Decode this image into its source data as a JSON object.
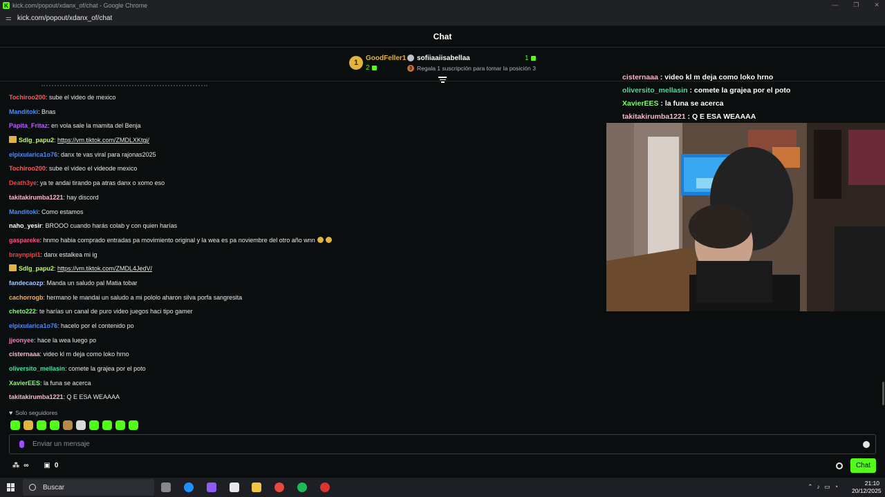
{
  "browser": {
    "window_title": "kick.com/popout/xdanx_of/chat - Google Chrome",
    "url": "kick.com/popout/xdanx_of/chat"
  },
  "chat": {
    "title": "Chat",
    "leaderboard": {
      "first": {
        "rank": "1",
        "name": "GoodFeller1",
        "count": "2"
      },
      "second": {
        "name": "sofiiaaiisabellaa",
        "count": "1"
      },
      "prompt": {
        "rank": "3",
        "text": "Regala 1 suscripción para tomar la posición 3"
      }
    },
    "messages": [
      {
        "user": "Tochiroo200",
        "color": "#ff5b5b",
        "text": ": sube el video de mexico"
      },
      {
        "user": "Manditoki",
        "color": "#4a8cff",
        "text": ": Bnas"
      },
      {
        "user": "Papita_Fritaz",
        "color": "#c15cff",
        "text": ": en vola sale la mamita del Benja"
      },
      {
        "user": "Sdlg_papu2",
        "color": "#b6ff5a",
        "text": ": ",
        "link": "https://vm.tiktok.com/ZMDLXKtgj/",
        "crown": true
      },
      {
        "user": "elpixularica1o76",
        "color": "#4a8cff",
        "text": ": danx te vas viral para rajonas2025"
      },
      {
        "user": "Tochiroo200",
        "color": "#ff5b5b",
        "text": ": sube el video el videode mexico"
      },
      {
        "user": "Death3ye",
        "color": "#ff3e3e",
        "text": ": ya te andai tirando pa atras danx o xomo eso"
      },
      {
        "user": "takitakirumba1221",
        "color": "#ffb8c8",
        "text": ": hay discord"
      },
      {
        "user": "Manditoki",
        "color": "#4a8cff",
        "text": ": Como estamos"
      },
      {
        "user": "naho_yesir",
        "color": "#ffffff",
        "text": ": BROOO cuando harás colab y con quien harías"
      },
      {
        "user": "gaspareke",
        "color": "#ff4e8a",
        "text": ": hnmo habia comprado entradas pa movimiento original y la wea es pa noviembre del otro año wnn",
        "emotes": 2
      },
      {
        "user": "braynpipi1",
        "color": "#ff3e3e",
        "text": ": danx estalkea mi ig"
      },
      {
        "user": "Sdlg_papu2",
        "color": "#b6ff5a",
        "text": ": ",
        "link": "https://vm.tiktok.com/ZMDL4JedV/",
        "crown": true
      },
      {
        "user": "fandecaozp",
        "color": "#a8c8ff",
        "text": ": Manda un saludo pal Matia tobar"
      },
      {
        "user": "cachorrogb",
        "color": "#ffb04a",
        "text": ": hermano le mandai un saludo a mi pololo aharon silva porfa sangresita"
      },
      {
        "user": "cheto222",
        "color": "#7dff6a",
        "text": ": te harías un canal de puro video juegos haci tipo gamer"
      },
      {
        "user": "elpixularica1o76",
        "color": "#4a8cff",
        "text": ": hacelo por el contenido po"
      },
      {
        "user": "jjeonyee",
        "color": "#ff78c0",
        "text": ": hace la wea luego po"
      },
      {
        "user": "cisternaaa",
        "color": "#ffb8c8",
        "text": ": video kl m deja como loko hrno"
      },
      {
        "user": "oliversito_mellasin",
        "color": "#4ae0a0",
        "text": ": comete la grajea por el poto"
      },
      {
        "user": "XavierEES",
        "color": "#7dff6a",
        "text": ": la funa se acerca"
      },
      {
        "user": "takitakirumba1221",
        "color": "#ffb8c8",
        "text": ": Q E ESA WEAAAA"
      }
    ],
    "overlay_messages": [
      {
        "user": "cisternaaa",
        "color": "#ffb8c8",
        "text": " : video kl m deja como loko hrno"
      },
      {
        "user": "oliversito_mellasin",
        "color": "#4ae0a0",
        "text": " : comete la grajea por el poto"
      },
      {
        "user": "XavierEES",
        "color": "#7dff6a",
        "text": " : la funa se acerca"
      },
      {
        "user": "takitakirumba1221",
        "color": "#ffb8c8",
        "text": " : Q E ESA WEAAAA"
      }
    ],
    "followers_only": "Solo seguidores",
    "input_placeholder": "Enviar un mensaje",
    "points": "0",
    "chat_button": "Chat",
    "accent": "#53fc18"
  },
  "taskbar": {
    "search_label": "Buscar",
    "time": "21:10",
    "date": "20/12/2025"
  }
}
